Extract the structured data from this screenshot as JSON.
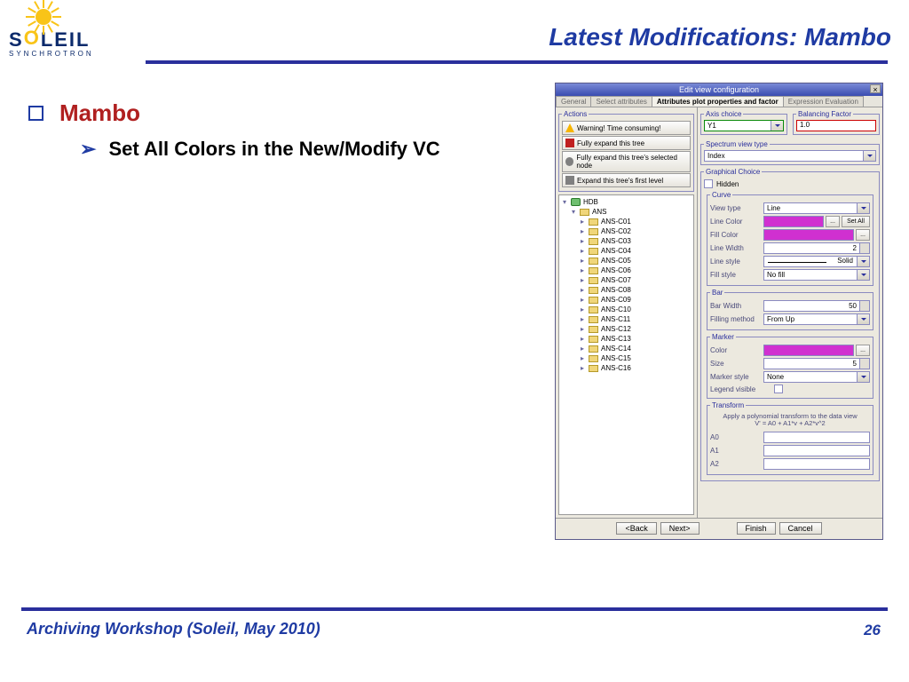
{
  "header": {
    "logo_word_pre": "S",
    "logo_word_mid": "O",
    "logo_word_post": "LEIL",
    "logo_sub": "SYNCHROTRON",
    "title": "Latest Modifications: Mambo"
  },
  "bullets": {
    "level1": "Mambo",
    "level2": "Set All Colors in the New/Modify VC"
  },
  "app": {
    "title": "Edit view configuration",
    "tabs": [
      "General",
      "Select attributes",
      "Attributes plot properties and factor",
      "Expression Evaluation"
    ],
    "active_tab": 2,
    "actions": {
      "legend": "Actions",
      "warning": "Warning! Time consuming!",
      "expand_tree": "Fully expand this tree",
      "expand_selected": "Fully expand this tree's selected node",
      "expand_first": "Expand this tree's first level"
    },
    "tree": {
      "root": "HDB",
      "child": "ANS",
      "leaves": [
        "ANS-C01",
        "ANS-C02",
        "ANS-C03",
        "ANS-C04",
        "ANS-C05",
        "ANS-C06",
        "ANS-C07",
        "ANS-C08",
        "ANS-C09",
        "ANS-C10",
        "ANS-C11",
        "ANS-C12",
        "ANS-C13",
        "ANS-C14",
        "ANS-C15",
        "ANS-C16"
      ]
    },
    "panels": {
      "axis": {
        "legend": "Axis choice",
        "value": "Y1"
      },
      "balancing": {
        "legend": "Balancing Factor",
        "value": "1.0"
      },
      "spectrum": {
        "legend": "Spectrum view type",
        "value": "Index"
      },
      "graphical": {
        "legend": "Graphical Choice",
        "hidden_label": "Hidden"
      },
      "curve": {
        "legend": "Curve",
        "view_type_label": "View type",
        "view_type": "Line",
        "line_color_label": "Line Color",
        "fill_color_label": "Fill Color",
        "line_width_label": "Line Width",
        "line_width": "2",
        "line_style_label": "Line style",
        "line_style": "Solid",
        "fill_style_label": "Fill style",
        "fill_style": "No fill",
        "setall": "Set All",
        "dots": "..."
      },
      "bar": {
        "legend": "Bar",
        "bar_width_label": "Bar Width",
        "bar_width": "50",
        "filling_label": "Filling method",
        "filling": "From Up"
      },
      "marker": {
        "legend": "Marker",
        "color_label": "Color",
        "size_label": "Size",
        "size": "5",
        "style_label": "Marker style",
        "style": "None",
        "legend_visible": "Legend visible",
        "dots": "..."
      },
      "transform": {
        "legend": "Transform",
        "note1": "Apply a polynomial transform to the data view",
        "note2": "V' = A0 + A1*v + A2*v^2",
        "a0": "A0",
        "a1": "A1",
        "a2": "A2"
      }
    },
    "buttons": {
      "back": "<Back",
      "next": "Next>",
      "finish": "Finish",
      "cancel": "Cancel"
    }
  },
  "footer": {
    "left": "Archiving Workshop (Soleil, May 2010)",
    "page": "26"
  }
}
